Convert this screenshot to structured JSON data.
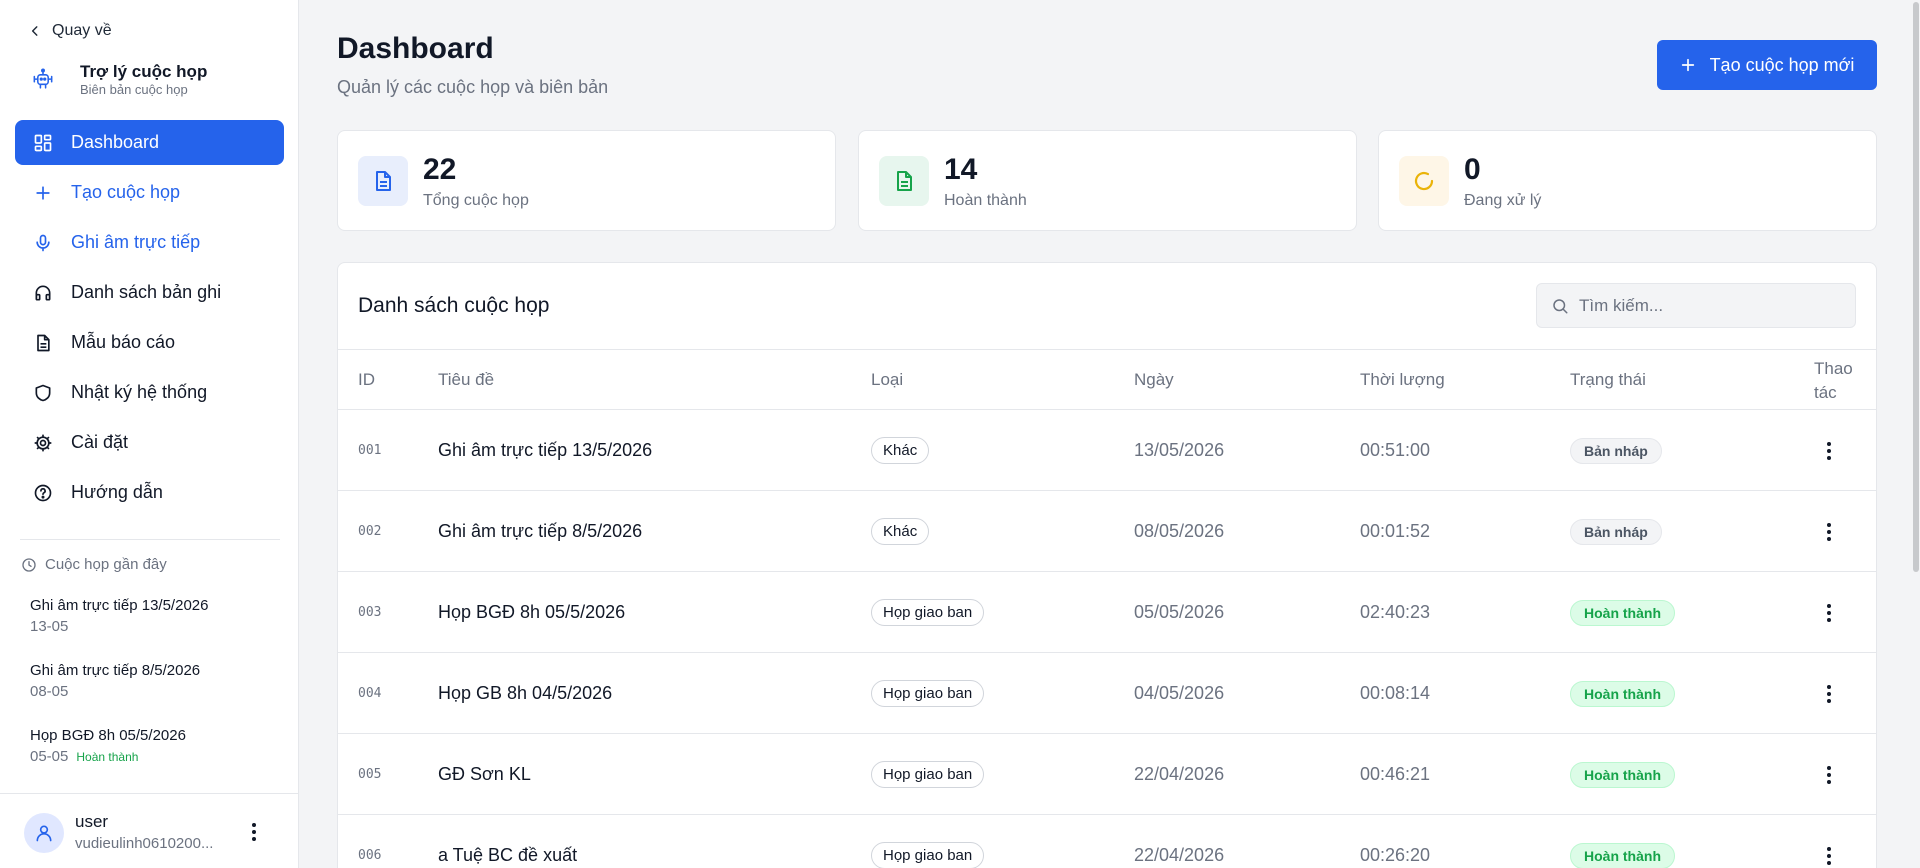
{
  "sidebar": {
    "back_label": "Quay về",
    "brand_title": "Trợ lý cuộc họp",
    "brand_subtitle": "Biên bản cuộc họp",
    "nav": [
      {
        "label": "Dashboard",
        "icon": "grid-icon"
      },
      {
        "label": "Tạo cuộc họp",
        "icon": "plus-icon"
      },
      {
        "label": "Ghi âm trực tiếp",
        "icon": "microphone-icon"
      },
      {
        "label": "Danh sách bản ghi",
        "icon": "headphones-icon"
      },
      {
        "label": "Mẫu báo cáo",
        "icon": "document-icon"
      },
      {
        "label": "Nhật ký hệ thống",
        "icon": "shield-icon"
      },
      {
        "label": "Cài đặt",
        "icon": "gear-icon"
      },
      {
        "label": "Hướng dẫn",
        "icon": "help-icon"
      }
    ],
    "recent_heading": "Cuộc họp gần đây",
    "recent": [
      {
        "title": "Ghi âm trực tiếp 13/5/2026",
        "date": "13-05",
        "status": ""
      },
      {
        "title": "Ghi âm trực tiếp 8/5/2026",
        "date": "08-05",
        "status": ""
      },
      {
        "title": "Họp BGĐ 8h 05/5/2026",
        "date": "05-05",
        "status": "Hoàn thành"
      }
    ],
    "user": {
      "name": "user",
      "email": "vudieulinh0610200..."
    }
  },
  "header": {
    "title": "Dashboard",
    "subtitle": "Quản lý các cuộc họp và biên bản",
    "create_button": "Tạo cuộc họp mới"
  },
  "stats": [
    {
      "value": "22",
      "label": "Tổng cuộc họp",
      "icon": "document-icon",
      "color": "#2563eb",
      "bg": "#e8eefc"
    },
    {
      "value": "14",
      "label": "Hoàn thành",
      "icon": "document-check-icon",
      "color": "#16a34a",
      "bg": "#e7f6ee"
    },
    {
      "value": "0",
      "label": "Đang xử lý",
      "icon": "loading-icon",
      "color": "#eab308",
      "bg": "#fef6e7"
    }
  ],
  "table": {
    "title": "Danh sách cuộc họp",
    "search_placeholder": "Tìm kiếm...",
    "columns": {
      "id": "ID",
      "title": "Tiêu đề",
      "type": "Loại",
      "date": "Ngày",
      "duration": "Thời lượng",
      "status": "Trạng thái",
      "actions_line1": "Thao",
      "actions_line2": "tác"
    },
    "rows": [
      {
        "id": "001",
        "title": "Ghi âm trực tiếp 13/5/2026",
        "type": "Khác",
        "date": "13/05/2026",
        "duration": "00:51:00",
        "status": "Bản nháp",
        "status_kind": "draft"
      },
      {
        "id": "002",
        "title": "Ghi âm trực tiếp 8/5/2026",
        "type": "Khác",
        "date": "08/05/2026",
        "duration": "00:01:52",
        "status": "Bản nháp",
        "status_kind": "draft"
      },
      {
        "id": "003",
        "title": "Họp BGĐ 8h 05/5/2026",
        "type": "Họp giao ban",
        "date": "05/05/2026",
        "duration": "02:40:23",
        "status": "Hoàn thành",
        "status_kind": "done"
      },
      {
        "id": "004",
        "title": "Họp GB 8h 04/5/2026",
        "type": "Họp giao ban",
        "date": "04/05/2026",
        "duration": "00:08:14",
        "status": "Hoàn thành",
        "status_kind": "done"
      },
      {
        "id": "005",
        "title": "GĐ Sơn KL",
        "type": "Họp giao ban",
        "date": "22/04/2026",
        "duration": "00:46:21",
        "status": "Hoàn thành",
        "status_kind": "done"
      },
      {
        "id": "006",
        "title": "a Tuệ BC đề xuất",
        "type": "Họp giao ban",
        "date": "22/04/2026",
        "duration": "00:26:20",
        "status": "Hoàn thành",
        "status_kind": "done"
      }
    ]
  },
  "colors": {
    "accent": "#2563eb",
    "success": "#16a34a",
    "warning": "#eab308"
  }
}
